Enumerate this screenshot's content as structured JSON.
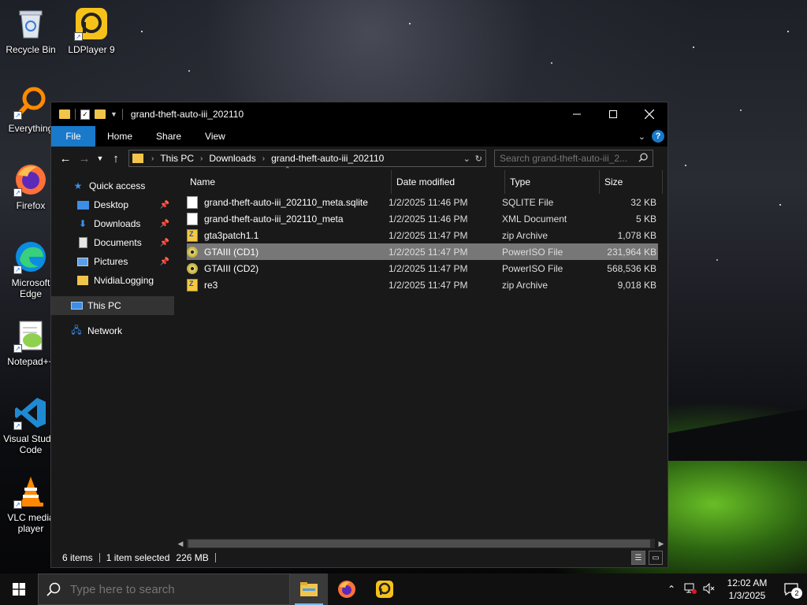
{
  "desktop": {
    "icons": [
      {
        "label": "Recycle Bin"
      },
      {
        "label": "LDPlayer 9"
      },
      {
        "label": "Everything"
      },
      {
        "label": "Firefox"
      },
      {
        "label": "Microsoft Edge"
      },
      {
        "label": "Notepad++"
      },
      {
        "label": "Visual Studio Code"
      },
      {
        "label": "VLC media player"
      }
    ]
  },
  "window": {
    "title": "grand-theft-auto-iii_202110",
    "ribbon_tabs": [
      "File",
      "Home",
      "Share",
      "View"
    ],
    "address": {
      "crumbs": [
        "This PC",
        "Downloads",
        "grand-theft-auto-iii_202110"
      ]
    },
    "search": {
      "placeholder": "Search grand-theft-auto-iii_2..."
    },
    "nav": {
      "quick_access": "Quick access",
      "items": [
        {
          "label": "Desktop",
          "pinned": true
        },
        {
          "label": "Downloads",
          "pinned": true
        },
        {
          "label": "Documents",
          "pinned": true
        },
        {
          "label": "Pictures",
          "pinned": true
        },
        {
          "label": "NvidiaLogging",
          "pinned": false
        }
      ],
      "this_pc": "This PC",
      "network": "Network"
    },
    "columns": [
      "Name",
      "Date modified",
      "Type",
      "Size"
    ],
    "files": [
      {
        "name": "grand-theft-auto-iii_202110_meta.sqlite",
        "date": "1/2/2025 11:46 PM",
        "type": "SQLITE File",
        "size": "32 KB",
        "icon": "document-icon"
      },
      {
        "name": "grand-theft-auto-iii_202110_meta",
        "date": "1/2/2025 11:46 PM",
        "type": "XML Document",
        "size": "5 KB",
        "icon": "xml-document-icon"
      },
      {
        "name": "gta3patch1.1",
        "date": "1/2/2025 11:47 PM",
        "type": "zip Archive",
        "size": "1,078 KB",
        "icon": "zip-archive-icon"
      },
      {
        "name": "GTAIII (CD1)",
        "date": "1/2/2025 11:47 PM",
        "type": "PowerISO File",
        "size": "231,964 KB",
        "icon": "disc-image-icon",
        "selected": true
      },
      {
        "name": "GTAIII (CD2)",
        "date": "1/2/2025 11:47 PM",
        "type": "PowerISO File",
        "size": "568,536 KB",
        "icon": "disc-image-icon"
      },
      {
        "name": "re3",
        "date": "1/2/2025 11:47 PM",
        "type": "zip Archive",
        "size": "9,018 KB",
        "icon": "zip-archive-icon"
      }
    ],
    "status": {
      "items": "6 items",
      "selected": "1 item selected",
      "size": "226 MB"
    }
  },
  "taskbar": {
    "search_placeholder": "Type here to search",
    "time": "12:02 AM",
    "date": "1/3/2025",
    "notification_count": "2"
  }
}
